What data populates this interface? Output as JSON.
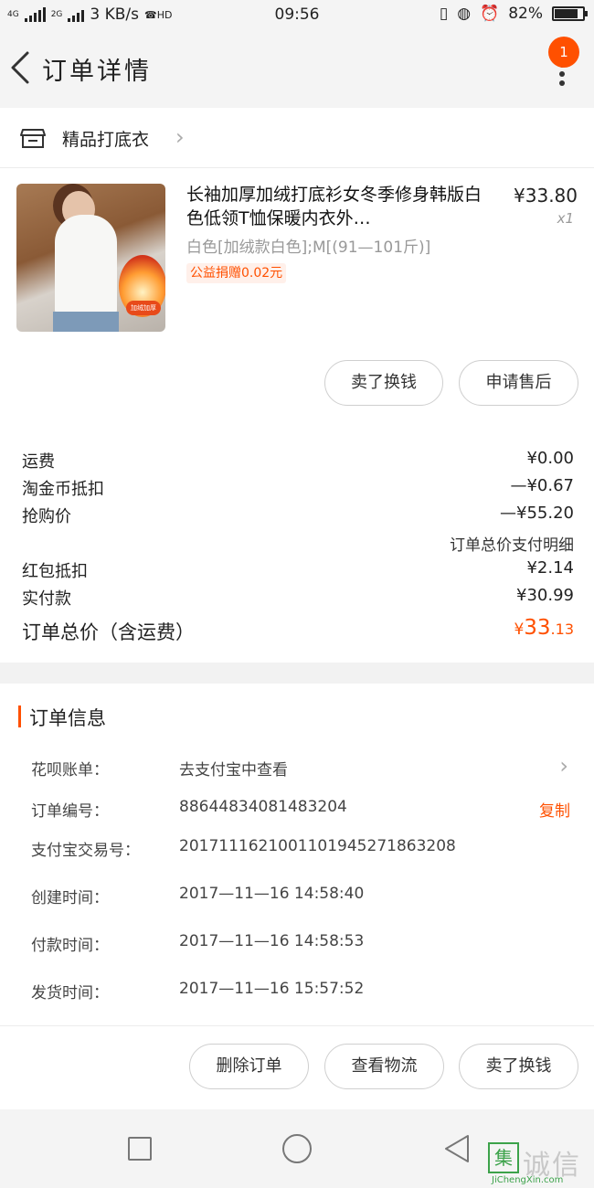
{
  "status_bar": {
    "network": "4G",
    "network2": "2G",
    "speed": "3 KB/s",
    "hd": "HD",
    "time": "09:56",
    "battery": "82%",
    "battery_level": 0.82
  },
  "nav": {
    "title": "订单详情",
    "badge": "1"
  },
  "shop": {
    "name": "精品打底衣"
  },
  "product": {
    "title": "长袖加厚加绒打底衫女冬季修身韩版白色低领T恤保暖内衣外…",
    "price": "¥33.80",
    "qty": "x1",
    "spec": "白色[加绒款白色];M[(91—101斤)]",
    "charity": "公益捐赠0.02元",
    "image_tag": "加绒加厚"
  },
  "actions1": {
    "sell": "卖了换钱",
    "after_sale": "申请售后"
  },
  "fees": [
    {
      "label": "运费",
      "value": "¥0.00"
    },
    {
      "label": "淘金币抵扣",
      "value": "—¥0.67"
    },
    {
      "label": "抢购价",
      "value": "—¥55.20"
    }
  ],
  "fee_detail_link": "订单总价支付明细",
  "fees2": [
    {
      "label": "红包抵扣",
      "value": "¥2.14"
    },
    {
      "label": "实付款",
      "value": "¥30.99"
    }
  ],
  "total": {
    "label": "订单总价（含运费）",
    "currency": "¥",
    "int": "33",
    "dec": ".13"
  },
  "order_info": {
    "title": "订单信息",
    "rows": [
      {
        "key": "花呗账单：",
        "value": "去支付宝中查看"
      },
      {
        "key": "订单编号：",
        "value": "88644834081483204",
        "action": "复制"
      },
      {
        "key": "支付宝交易号：",
        "value": "2017111621001101945271863208"
      },
      {
        "key": "创建时间：",
        "value": "2017—11—16 14:58:40"
      },
      {
        "key": "付款时间：",
        "value": "2017—11—16 14:58:53"
      },
      {
        "key": "发货时间：",
        "value": "2017—11—16 15:57:52"
      }
    ]
  },
  "bottom_actions": {
    "delete": "删除订单",
    "logistics": "查看物流",
    "sell": "卖了换钱"
  },
  "watermark": {
    "logo": "集",
    "cn": "诚信",
    "en": "JiChengXin.com"
  }
}
